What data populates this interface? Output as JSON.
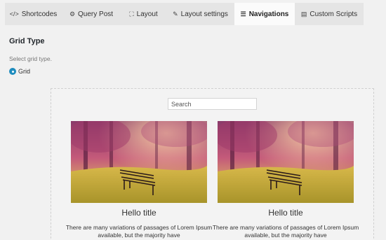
{
  "tabs": [
    {
      "label": "Shortcodes",
      "icon": "code-icon",
      "glyph": "</>"
    },
    {
      "label": "Query Post",
      "icon": "query-icon",
      "glyph": "⚙"
    },
    {
      "label": "Layout",
      "icon": "layout-icon",
      "glyph": "⛶"
    },
    {
      "label": "Layout settings",
      "icon": "brush-icon",
      "glyph": "✎"
    },
    {
      "label": "Navigations",
      "icon": "sliders-icon",
      "glyph": "☰",
      "active": true
    },
    {
      "label": "Custom Scripts",
      "icon": "script-icon",
      "glyph": "▤"
    }
  ],
  "grid_type": {
    "title": "Grid Type",
    "help": "Select grid type.",
    "option_label": "Grid",
    "selected": true
  },
  "preview": {
    "search_placeholder": "Search",
    "cards": [
      {
        "title": "Hello title",
        "text": "There are many variations of passages of Lorem Ipsum available, but the majority have"
      },
      {
        "title": "Hello title",
        "text": "There are many variations of passages of Lorem Ipsum available, but the majority have"
      }
    ]
  },
  "colors": {
    "accent": "#1e8cbe",
    "tab_bar": "#e5e5e5",
    "active_tab": "#fbfbfb"
  }
}
